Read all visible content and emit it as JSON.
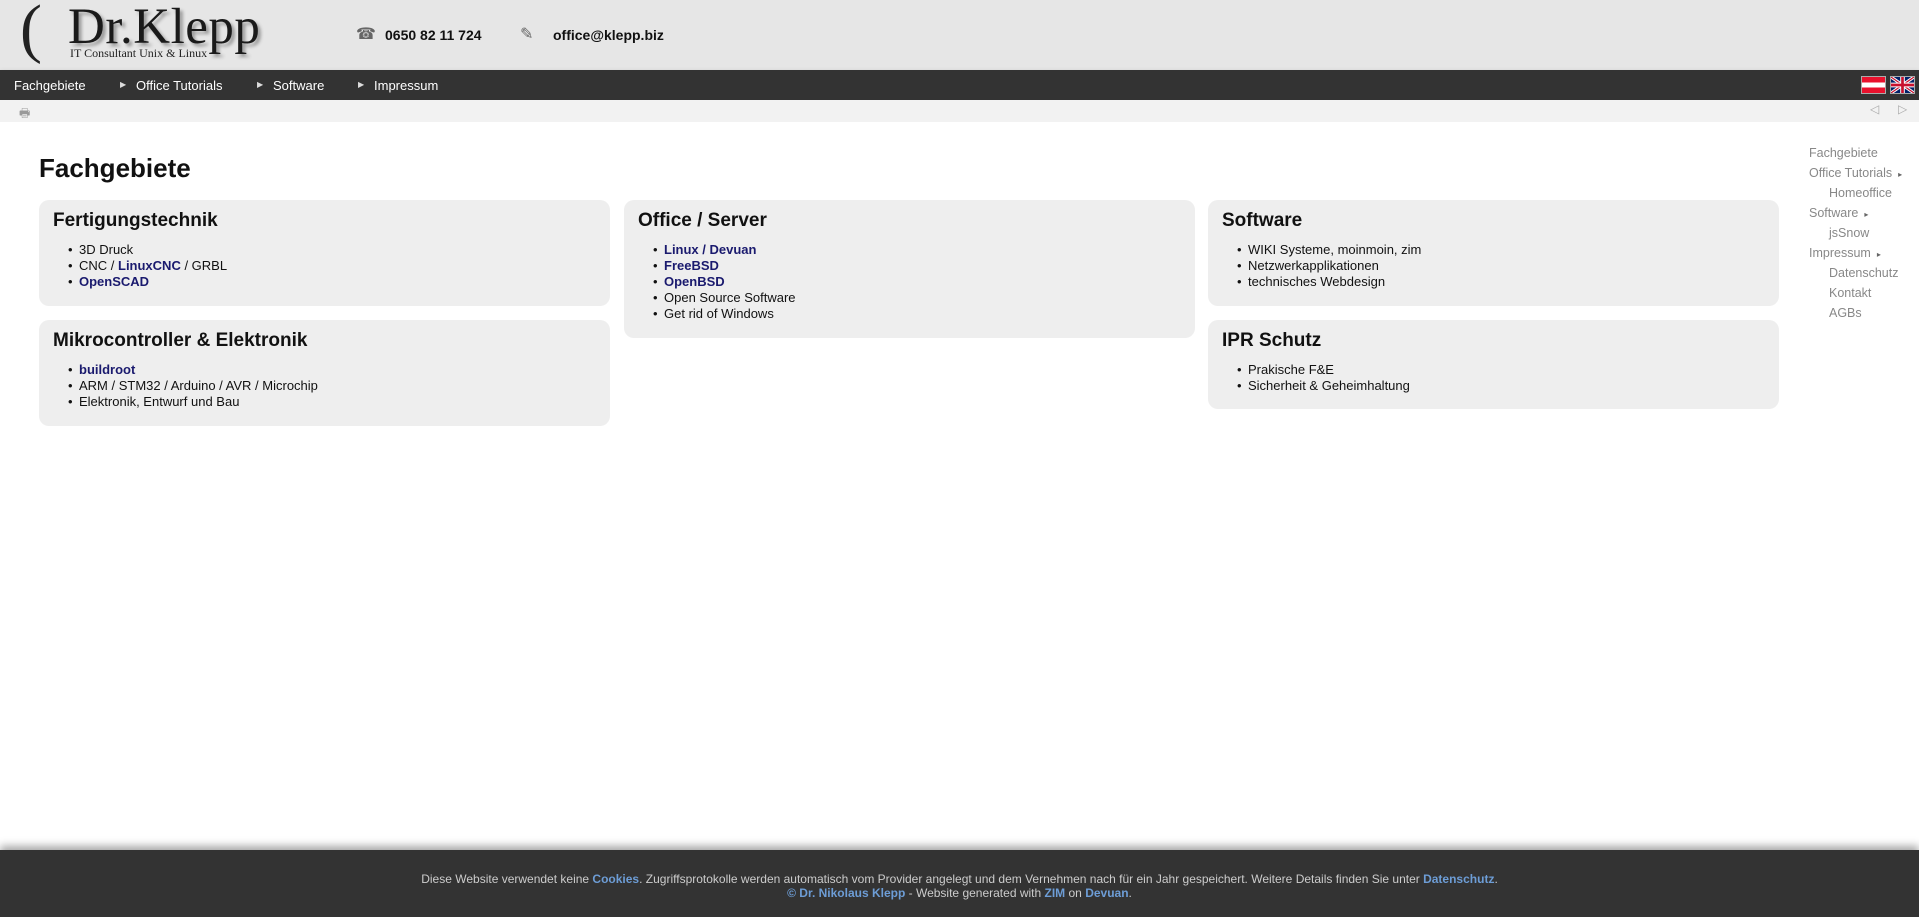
{
  "header": {
    "logo_name": "Dr.Klepp",
    "logo_tagline": "IT Consultant Unix & Linux",
    "phone": "0650 82 11 724",
    "email": "office@klepp.biz",
    "phone_icon": "phone-icon",
    "email_icon": "pencil-icon"
  },
  "nav": {
    "items": [
      {
        "label": "Fachgebiete"
      },
      {
        "label": "Office Tutorials"
      },
      {
        "label": "Software"
      },
      {
        "label": "Impressum"
      }
    ],
    "flags": [
      "austria-flag-icon",
      "uk-flag-icon"
    ]
  },
  "toolbar": {
    "icons": [
      "print-icon",
      "prev-icon",
      "next-icon"
    ]
  },
  "main": {
    "title": "Fachgebiete",
    "boxes": {
      "fertigung": {
        "title": "Fertigungstechnik",
        "items": [
          {
            "text": "3D Druck"
          },
          {
            "pre": "CNC / ",
            "link": "LinuxCNC",
            "post": " / GRBL"
          },
          {
            "link": "OpenSCAD"
          }
        ]
      },
      "mikro": {
        "title": "Mikrocontroller & Elektronik",
        "items": [
          {
            "link": "buildroot"
          },
          {
            "text": "ARM / STM32 / Arduino / AVR / Microchip"
          },
          {
            "text": "Elektronik, Entwurf und Bau"
          }
        ]
      },
      "office": {
        "title": "Office / Server",
        "items": [
          {
            "link": "Linux",
            "sep": " / ",
            "link2": "Devuan"
          },
          {
            "link": "FreeBSD"
          },
          {
            "link": "OpenBSD"
          },
          {
            "text": "Open Source Software"
          },
          {
            "text": "Get rid of Windows"
          }
        ]
      },
      "software": {
        "title": "Software",
        "items": [
          {
            "text": "WIKI Systeme, moinmoin, zim"
          },
          {
            "text": "Netzwerkapplikationen"
          },
          {
            "text": "technisches Webdesign"
          }
        ]
      },
      "ipr": {
        "title": "IPR Schutz",
        "items": [
          {
            "text": "Prakische F&E"
          },
          {
            "text": "Sicherheit & Geheimhaltung"
          }
        ]
      }
    }
  },
  "sidebar": {
    "items": [
      {
        "label": "Fachgebiete",
        "arrow": ""
      },
      {
        "label": "Office Tutorials",
        "arrow": "▸"
      },
      {
        "label": "Homeoffice",
        "arrow": ""
      },
      {
        "label": "Software",
        "arrow": "▸"
      },
      {
        "label": "jsSnow",
        "arrow": ""
      },
      {
        "label": "Impressum",
        "arrow": "▸"
      },
      {
        "label": "Datenschutz",
        "arrow": ""
      },
      {
        "label": "Kontakt",
        "arrow": ""
      },
      {
        "label": "AGBs",
        "arrow": ""
      }
    ]
  },
  "footer": {
    "line1_pre": "Diese Website verwendet keine ",
    "line1_link1": "Cookies",
    "line1_mid": ". Zugriffsprotokolle werden automatisch vom Provider angelegt und dem Vernehmen nach für ein Jahr gespeichert. Weitere Details finden Sie unter ",
    "line1_link2": "Datenschutz",
    "line1_post": ".",
    "line2_link1": "© Dr. Nikolaus Klepp",
    "line2_mid": " - Website generated with ",
    "line2_link2": "ZIM",
    "line2_mid2": " on ",
    "line2_link3": "Devuan",
    "line2_post": "."
  },
  "colors": {
    "header_bg": "#e6e6e6",
    "nav_bg": "#333333",
    "box_bg": "#eeeeee",
    "link": "#1a1a6e",
    "footer_link": "#6d9dd6"
  }
}
